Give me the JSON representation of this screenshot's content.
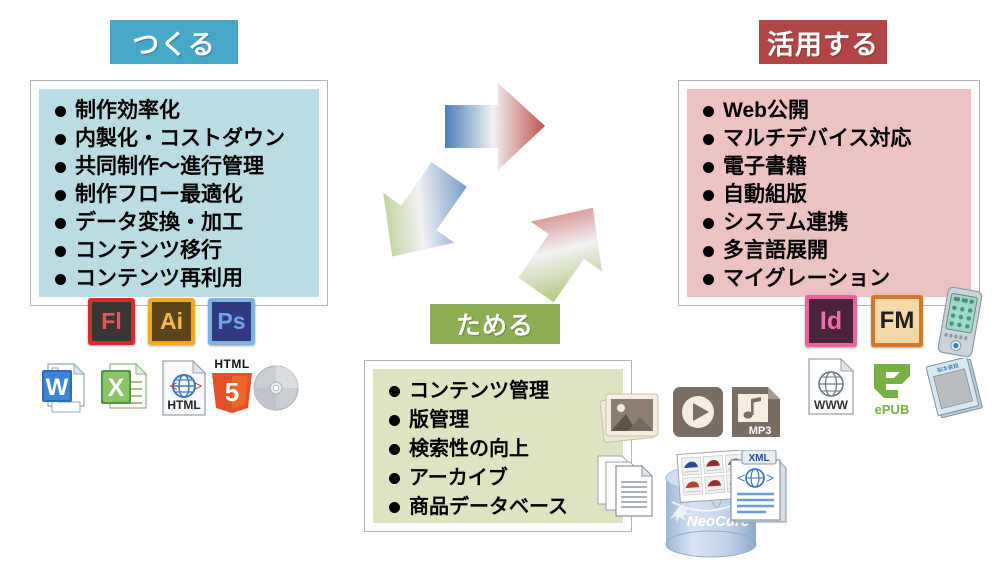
{
  "diagram": {
    "title_stages": [
      "つくる",
      "ためる",
      "活用する"
    ],
    "stages": {
      "create": {
        "header": "つくる",
        "header_color": "#46A8C6",
        "panel_color": "#BCDCE4",
        "items": [
          "制作効率化",
          "内製化・コストダウン",
          "共同制作〜進行管理",
          "制作フロー最適化",
          "データ変換・加工",
          "コンテンツ移行",
          "コンテンツ再利用"
        ],
        "app_icons": [
          {
            "name": "flash-icon",
            "label": "Fl",
            "frame": "#D42B2B",
            "body": "#3A3432",
            "text": "#E05A5A"
          },
          {
            "name": "illustrator-icon",
            "label": "Ai",
            "frame": "#F5A623",
            "body": "#5C4518",
            "text": "#F7B94C"
          },
          {
            "name": "photoshop-icon",
            "label": "Ps",
            "frame": "#7FB4E0",
            "body": "#303A80",
            "text": "#6FA8E8"
          }
        ],
        "file_icons": [
          {
            "name": "word-doc-icon",
            "label": "W"
          },
          {
            "name": "excel-doc-icon",
            "label": "X"
          },
          {
            "name": "html-file-icon",
            "label": "HTML"
          },
          {
            "name": "html5-logo-icon",
            "label": "HTML"
          },
          {
            "name": "disc-icon",
            "label": ""
          }
        ],
        "html5_top_label": "HTML",
        "html5_number": "5",
        "html_file_label": "HTML"
      },
      "store": {
        "header": "ためる",
        "header_color": "#8CAE52",
        "panel_color": "#DCE4C2",
        "items": [
          "コンテンツ管理",
          "版管理",
          "検索性の向上",
          "アーカイブ",
          "商品データベース"
        ],
        "media_icons": [
          {
            "name": "photo-stack-icon",
            "label": ""
          },
          {
            "name": "video-play-icon",
            "label": ""
          },
          {
            "name": "mp3-file-icon",
            "label": "MP3"
          }
        ],
        "database_label": "NeoCore",
        "database_trademark": "®",
        "xml_badge": "XML",
        "xml_brackets": "< >"
      },
      "use": {
        "header": "活用する",
        "header_color": "#B24646",
        "panel_color": "#EDC2C2",
        "items": [
          "Web公開",
          "マルチデバイス対応",
          "電子書籍",
          "自動組版",
          "システム連携",
          "多言語展開",
          "マイグレーション"
        ],
        "app_icons": [
          {
            "name": "indesign-icon",
            "label": "Id",
            "frame": "#E8649F",
            "body": "#49233A",
            "text": "#F06EB0"
          },
          {
            "name": "framemaker-icon",
            "label": "FM",
            "frame": "#D4772B",
            "body": "#F7D9A8",
            "text": "#231F20"
          }
        ],
        "output_icons": [
          {
            "name": "pda-device-icon",
            "label": ""
          },
          {
            "name": "www-file-icon",
            "label": "WWW"
          },
          {
            "name": "epub-logo-icon",
            "label": "ePUB"
          },
          {
            "name": "printed-book-icon",
            "label": ""
          }
        ],
        "epub_label": "ePUB",
        "www_label": "WWW"
      }
    },
    "arrows": [
      {
        "name": "arrow-create-to-use",
        "from_color": "#4A7EBB",
        "to_color": "#C0504D",
        "direction": "right"
      },
      {
        "name": "arrow-create-to-store",
        "from_color": "#4A7EBB",
        "to_color": "#9BBB59",
        "direction": "down-right"
      },
      {
        "name": "arrow-store-to-use",
        "from_color": "#9BBB59",
        "to_color": "#C0504D",
        "direction": "up-right"
      }
    ]
  }
}
